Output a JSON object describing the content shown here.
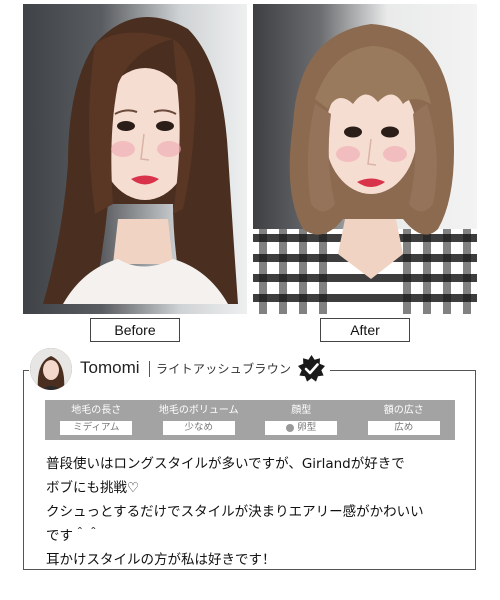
{
  "photos": {
    "before_label": "Before",
    "after_label": "After"
  },
  "review": {
    "user_name": "Tomomi",
    "hair_color": "ライトアッシュブラウン",
    "attributes": [
      {
        "title": "地毛の長さ",
        "value": "ミディアム"
      },
      {
        "title": "地毛のボリューム",
        "value": "少なめ"
      },
      {
        "title": "顔型",
        "value": "卵型"
      },
      {
        "title": "額の広さ",
        "value": "広め"
      }
    ],
    "comment_lines": [
      "普段使いはロングスタイルが多いですが、Girlandが好きで",
      "ボブにも挑戦♡",
      "クシュっとするだけでスタイルが決まりエアリー感がかわいい",
      "です＾＾",
      "耳かけスタイルの方が私は好きです！"
    ]
  },
  "colors": {
    "attribute_strip": "#a3a3a3",
    "border": "#555555",
    "badge": "#1a1a1a"
  }
}
